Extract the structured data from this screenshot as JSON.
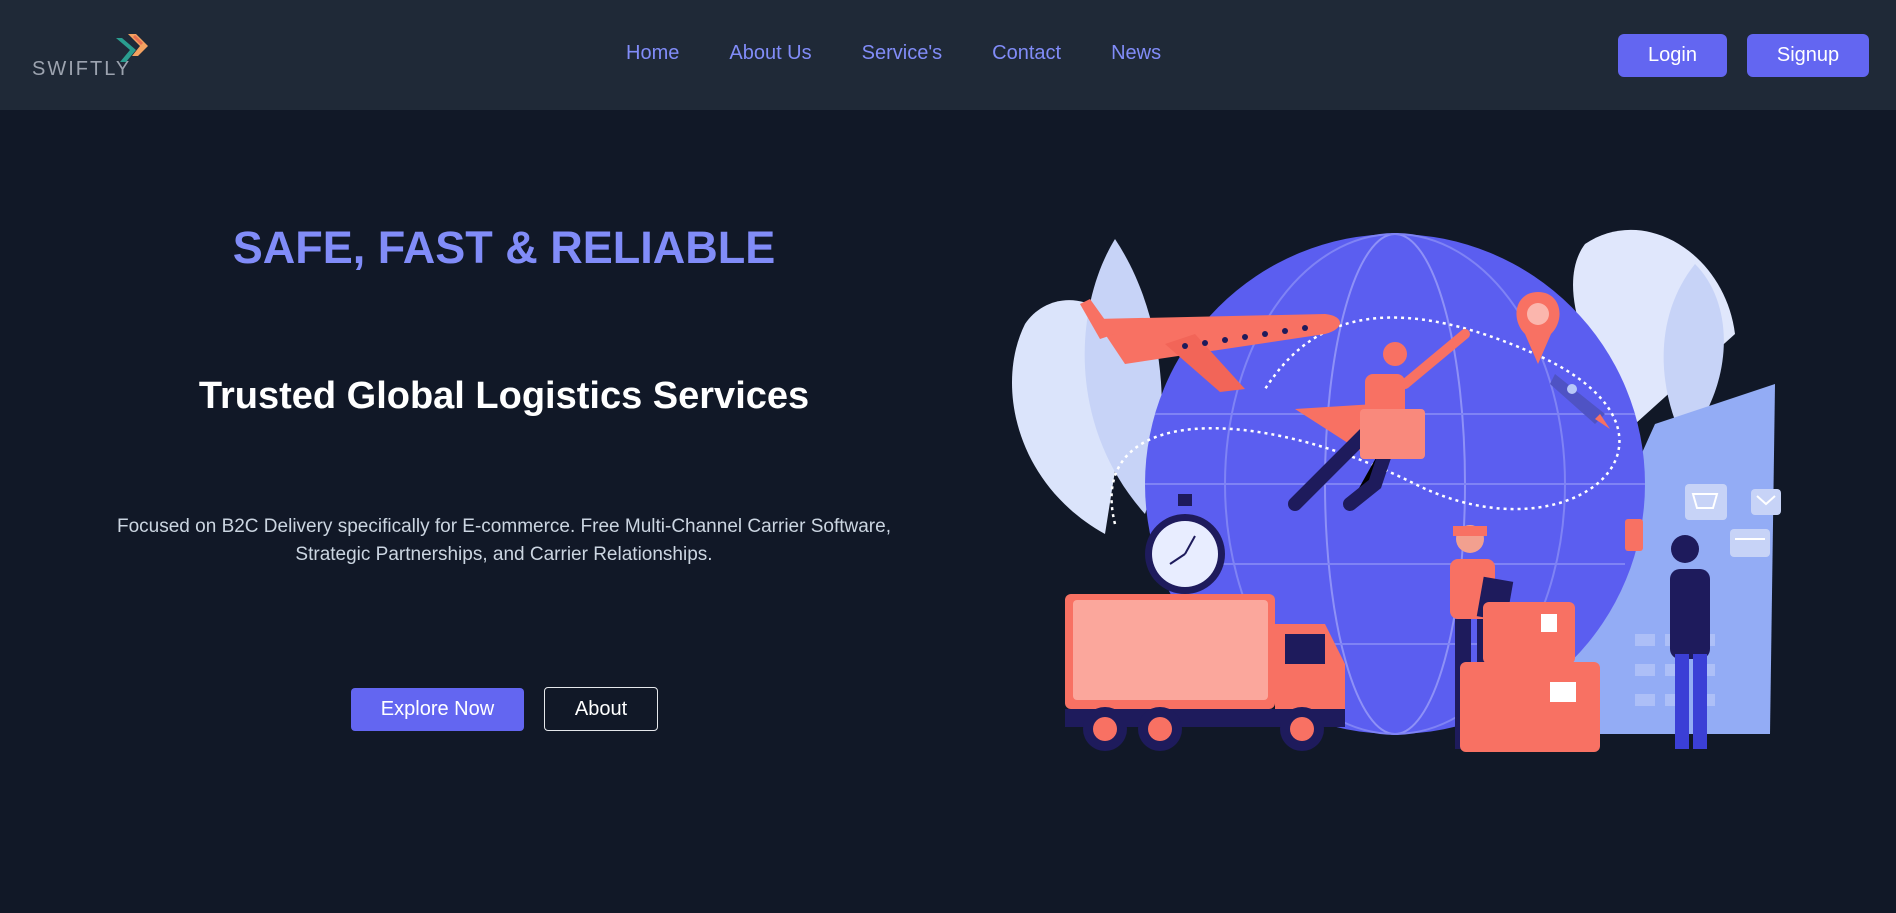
{
  "brand": {
    "name": "SWIFTLY"
  },
  "nav": {
    "links": [
      "Home",
      "About Us",
      "Service's",
      "Contact",
      "News"
    ],
    "login_label": "Login",
    "signup_label": "Signup"
  },
  "hero": {
    "tagline": "SAFE, FAST & RELIABLE",
    "title": "Trusted Global Logistics Services",
    "description": "Focused on B2C Delivery specifically for E-commerce. Free Multi-Channel Carrier Software, Strategic Partnerships, and Carrier Relationships.",
    "explore_label": "Explore Now",
    "about_label": "About"
  },
  "colors": {
    "background": "#111827",
    "navbar": "#1f2937",
    "accent": "#6366f1",
    "accent_text": "#818cf8",
    "illustration_coral": "#f87163"
  }
}
